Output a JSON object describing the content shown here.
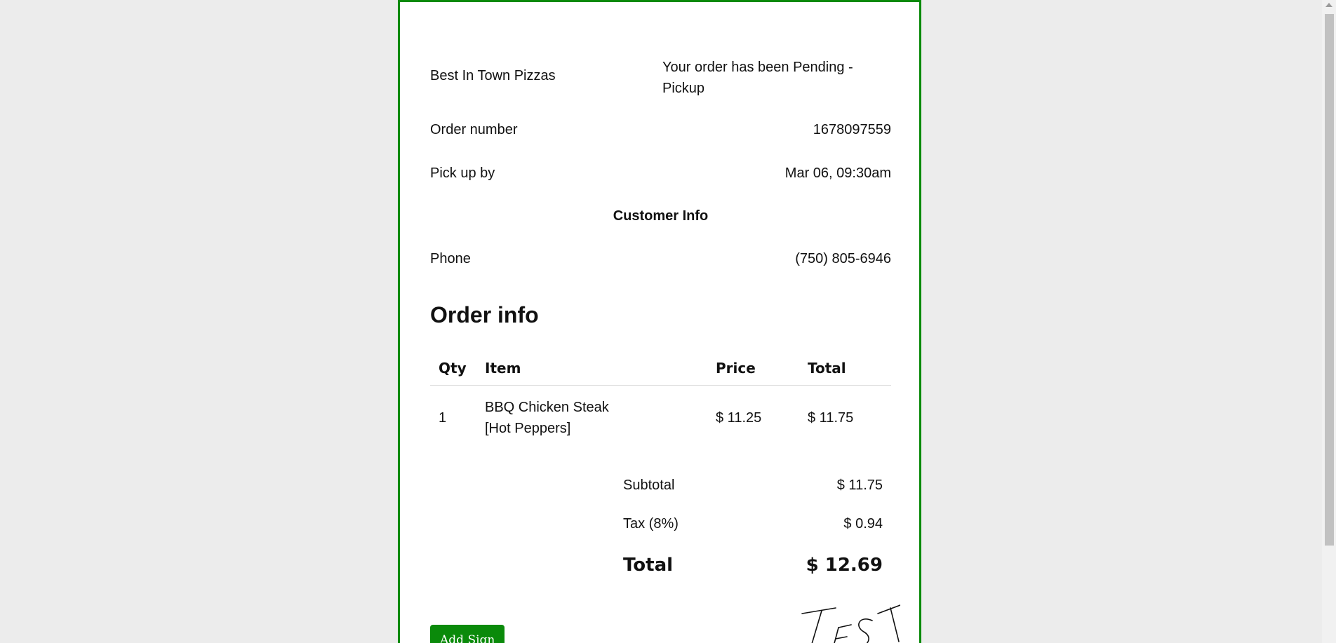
{
  "store": {
    "name": "Best In Town Pizzas",
    "status_message": "Your order has been Pending - Pickup"
  },
  "order": {
    "number_label": "Order number",
    "number_value": "1678097559",
    "pickup_label": "Pick up by",
    "pickup_value": "Mar 06, 09:30am"
  },
  "customer": {
    "section_title": "Customer Info",
    "phone_label": "Phone",
    "phone_value": "(750) 805-6946"
  },
  "order_info": {
    "title": "Order info",
    "columns": {
      "qty": "Qty",
      "item": "Item",
      "price": "Price",
      "total": "Total"
    },
    "rows": [
      {
        "qty": "1",
        "item": "BBQ Chicken Steak",
        "modifiers": "[Hot Peppers]",
        "price": "$ 11.25",
        "total": "$ 11.75"
      }
    ]
  },
  "summary": {
    "subtotal_label": "Subtotal",
    "subtotal_value": "$ 11.75",
    "tax_label": "Tax (8%)",
    "tax_value": "$ 0.94",
    "total_label": "Total",
    "total_value": "$ 12.69"
  },
  "actions": {
    "add_sign_label": "Add Sign"
  },
  "signature": {
    "text": "TEST"
  },
  "colors": {
    "accent": "#0a8a0a",
    "page_bg": "#ececec"
  }
}
